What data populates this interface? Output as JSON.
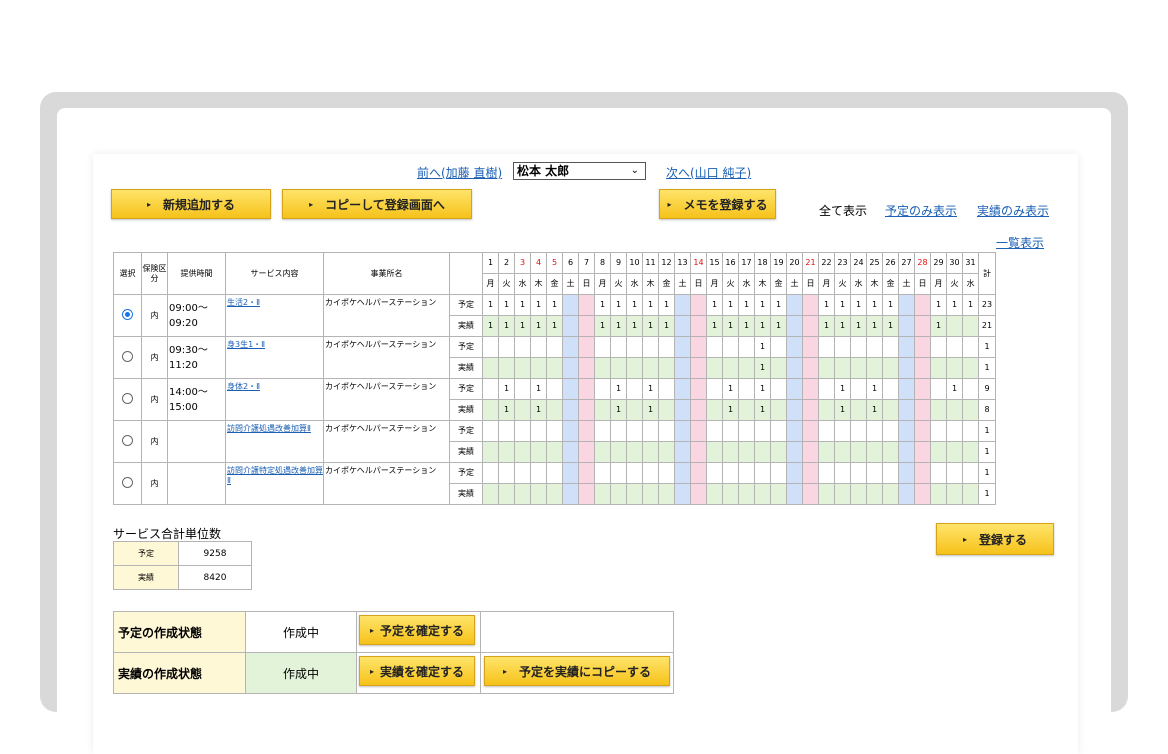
{
  "nav": {
    "prev_label": "前へ(加藤 直樹)",
    "current_user": "松本 太郎",
    "next_label": "次へ(山口 純子)"
  },
  "toolbar": {
    "new_label": "新規追加する",
    "copy_label": "コピーして登録画面へ",
    "memo_label": "メモを登録する",
    "view_all": "全て表示",
    "view_plan": "予定のみ表示",
    "view_actual": "実績のみ表示",
    "list_view": "一覧表示"
  },
  "grid": {
    "headers": {
      "select": "選択",
      "insurance": "保険区分",
      "time": "提供時間",
      "service": "サービス内容",
      "office": "事業所名",
      "total": "計"
    },
    "days": [
      "1",
      "2",
      "3",
      "4",
      "5",
      "6",
      "7",
      "8",
      "9",
      "10",
      "11",
      "12",
      "13",
      "14",
      "15",
      "16",
      "17",
      "18",
      "19",
      "20",
      "21",
      "22",
      "23",
      "24",
      "25",
      "26",
      "27",
      "28",
      "29",
      "30",
      "31"
    ],
    "weekdays": [
      "月",
      "火",
      "水",
      "木",
      "金",
      "土",
      "日",
      "月",
      "火",
      "水",
      "木",
      "金",
      "土",
      "日",
      "月",
      "火",
      "水",
      "木",
      "金",
      "土",
      "日",
      "月",
      "火",
      "水",
      "木",
      "金",
      "土",
      "日",
      "月",
      "火",
      "水"
    ],
    "red_days": [
      3,
      4,
      5,
      14,
      21,
      28
    ],
    "plan_label": "予定",
    "actual_label": "実績",
    "rows": [
      {
        "selected": true,
        "insurance": "内",
        "time_start": "09:00〜",
        "time_end": "09:20",
        "service": "生活2・Ⅱ",
        "office": "カイポケヘルパーステーション",
        "plan": [
          "1",
          "1",
          "1",
          "1",
          "1",
          "",
          "",
          "1",
          "1",
          "1",
          "1",
          "1",
          "",
          "",
          "1",
          "1",
          "1",
          "1",
          "1",
          "",
          "",
          "1",
          "1",
          "1",
          "1",
          "1",
          "",
          "",
          "1",
          "1",
          "1"
        ],
        "plan_total": "23",
        "actual": [
          "1",
          "1",
          "1",
          "1",
          "1",
          "",
          "",
          "1",
          "1",
          "1",
          "1",
          "1",
          "",
          "",
          "1",
          "1",
          "1",
          "1",
          "1",
          "",
          "",
          "1",
          "1",
          "1",
          "1",
          "1",
          "",
          "",
          "1",
          "",
          ""
        ],
        "actual_total": "21"
      },
      {
        "selected": false,
        "insurance": "内",
        "time_start": "09:30〜",
        "time_end": "11:20",
        "service": "身3生1・Ⅱ",
        "office": "カイポケヘルパーステーション",
        "plan": [
          "",
          "",
          "",
          "",
          "",
          "",
          "",
          "",
          "",
          "",
          "",
          "",
          "",
          "",
          "",
          "",
          "",
          "1",
          "",
          "",
          "",
          "",
          "",
          "",
          "",
          "",
          "",
          "",
          "",
          "",
          ""
        ],
        "plan_total": "1",
        "actual": [
          "",
          "",
          "",
          "",
          "",
          "",
          "",
          "",
          "",
          "",
          "",
          "",
          "",
          "",
          "",
          "",
          "",
          "1",
          "",
          "",
          "",
          "",
          "",
          "",
          "",
          "",
          "",
          "",
          "",
          "",
          ""
        ],
        "actual_total": "1"
      },
      {
        "selected": false,
        "insurance": "内",
        "time_start": "14:00〜",
        "time_end": "15:00",
        "service": "身体2・Ⅱ",
        "office": "カイポケヘルパーステーション",
        "plan": [
          "",
          "1",
          "",
          "1",
          "",
          "",
          "",
          "",
          "1",
          "",
          "1",
          "",
          "",
          "",
          "",
          "1",
          "",
          "1",
          "",
          "",
          "",
          "",
          "1",
          "",
          "1",
          "",
          "",
          "",
          "",
          "1",
          ""
        ],
        "plan_total": "9",
        "actual": [
          "",
          "1",
          "",
          "1",
          "",
          "",
          "",
          "",
          "1",
          "",
          "1",
          "",
          "",
          "",
          "",
          "1",
          "",
          "1",
          "",
          "",
          "",
          "",
          "1",
          "",
          "1",
          "",
          "",
          "",
          "",
          "",
          ""
        ],
        "actual_total": "8"
      },
      {
        "selected": false,
        "insurance": "内",
        "time_start": "",
        "time_end": "",
        "service": "訪問介護処遇改善加算Ⅱ",
        "office": "カイポケヘルパーステーション",
        "plan": [
          "",
          "",
          "",
          "",
          "",
          "",
          "",
          "",
          "",
          "",
          "",
          "",
          "",
          "",
          "",
          "",
          "",
          "",
          "",
          "",
          "",
          "",
          "",
          "",
          "",
          "",
          "",
          "",
          "",
          "",
          ""
        ],
        "plan_total": "1",
        "actual": [
          "",
          "",
          "",
          "",
          "",
          "",
          "",
          "",
          "",
          "",
          "",
          "",
          "",
          "",
          "",
          "",
          "",
          "",
          "",
          "",
          "",
          "",
          "",
          "",
          "",
          "",
          "",
          "",
          "",
          "",
          ""
        ],
        "actual_total": "1"
      },
      {
        "selected": false,
        "insurance": "内",
        "time_start": "",
        "time_end": "",
        "service": "訪問介護特定処遇改善加算Ⅱ",
        "office": "カイポケヘルパーステーション",
        "plan": [
          "",
          "",
          "",
          "",
          "",
          "",
          "",
          "",
          "",
          "",
          "",
          "",
          "",
          "",
          "",
          "",
          "",
          "",
          "",
          "",
          "",
          "",
          "",
          "",
          "",
          "",
          "",
          "",
          "",
          "",
          ""
        ],
        "plan_total": "1",
        "actual": [
          "",
          "",
          "",
          "",
          "",
          "",
          "",
          "",
          "",
          "",
          "",
          "",
          "",
          "",
          "",
          "",
          "",
          "",
          "",
          "",
          "",
          "",
          "",
          "",
          "",
          "",
          "",
          "",
          "",
          "",
          ""
        ],
        "actual_total": "1"
      }
    ]
  },
  "summary": {
    "title": "サービス合計単位数",
    "plan_label": "予定",
    "plan_value": "9258",
    "actual_label": "実績",
    "actual_value": "8420"
  },
  "register_label": "登録する",
  "status": {
    "plan_state_label": "予定の作成状態",
    "plan_state_value": "作成中",
    "confirm_plan_label": "予定を確定する",
    "actual_state_label": "実績の作成状態",
    "actual_state_value": "作成中",
    "confirm_actual_label": "実績を確定する",
    "copy_plan_label": "予定を実績にコピーする"
  },
  "colors": {
    "button_yellow": "#f6c21a",
    "saturday": "#cfe0f8",
    "sunday": "#f9d6e1",
    "actual_row": "#e3f3da",
    "link": "#1a5fb4"
  }
}
